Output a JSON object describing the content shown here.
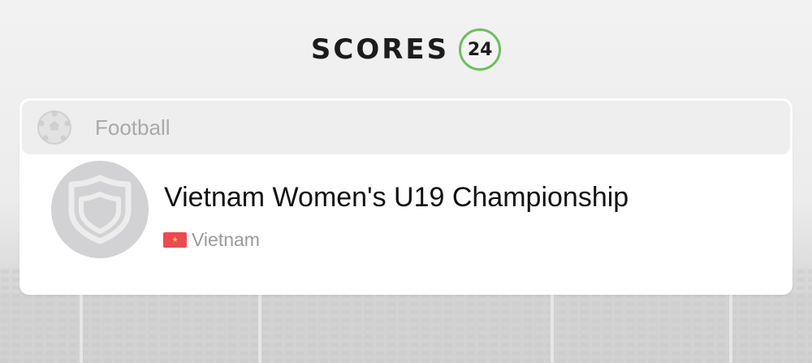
{
  "brand": {
    "name": "SCORES",
    "badge": "24",
    "accent_color": "#6dbe5e"
  },
  "sport": {
    "label": "Football",
    "icon": "soccer-ball-icon"
  },
  "tournament": {
    "title": "Vietnam Women's U19 Championship",
    "emblem_icon": "shield-icon",
    "country": "Vietnam",
    "flag_icon": "vietnam-flag-icon",
    "flag_color": "#e94b52",
    "flag_star_color": "#f6d33a"
  }
}
